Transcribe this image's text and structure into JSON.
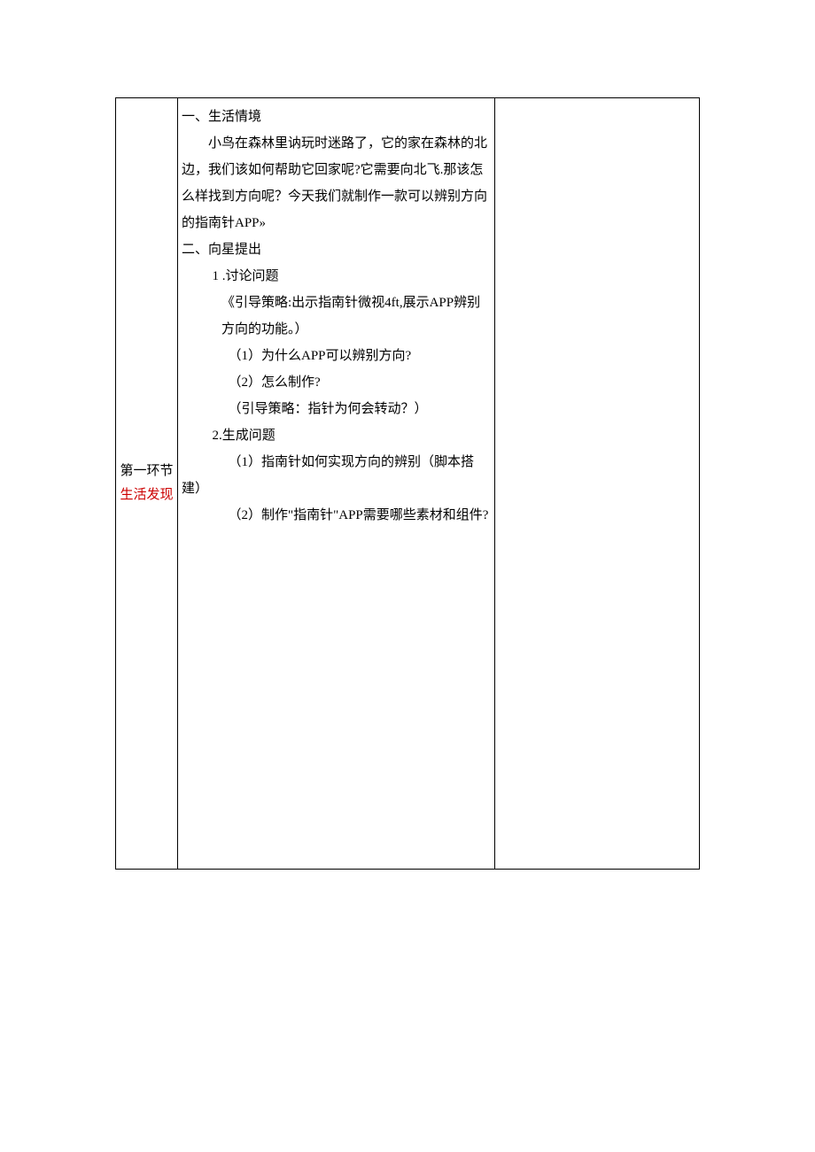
{
  "left": {
    "title1": "第一环节",
    "title2": "生活发现"
  },
  "middle": {
    "h1": "一、生活情境",
    "p1": "小鸟在森林里讷玩时迷路了，它的家在森林的北边，我们该如何帮助它回家呢?它需要向北飞.那该怎么样找到方向呢？今天我们就制作一款可以辨别方向的指南针APP»",
    "h2": "二、向星提出",
    "s1": "1 .讨论问题",
    "s1a": "《引导策略:出示指南针微视4ft,展示APP辨别方向的功能。）",
    "s1b": "（1）为什么APP可以辨别方向?",
    "s1c": "（2）怎么制作?",
    "s1d": "（引导策略：指针为何会转动？）",
    "s2": "2.生成问题",
    "s2a": "（1）指南针如何实现方向的辨别（脚本搭建）",
    "s2b": "（2）制作\"指南针\"APP需要哪些素材和组件?"
  }
}
